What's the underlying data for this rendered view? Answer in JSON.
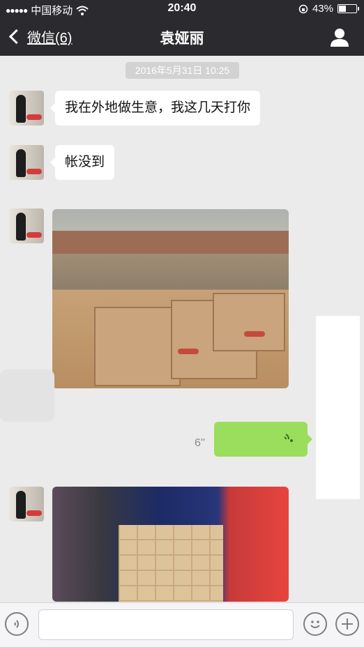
{
  "status_bar": {
    "signal_dots": "●●●●●",
    "carrier": "中国移动",
    "time": "20:40",
    "battery_percent": "43%",
    "battery_level": 0.43
  },
  "nav": {
    "back_label": "微信(6)",
    "title": "袁娅丽"
  },
  "chat": {
    "timestamp": "2016年5月31日 10:25",
    "messages": [
      {
        "from": "contact",
        "type": "text",
        "text": "我在外地做生意，我这几天打你"
      },
      {
        "from": "contact",
        "type": "text",
        "text": "帐没到"
      },
      {
        "from": "contact",
        "type": "image",
        "subject": "strawberry boxes at a market"
      },
      {
        "from": "me",
        "type": "voice",
        "duration": "6''"
      },
      {
        "from": "contact",
        "type": "image",
        "subject": "strawberry boxes in a truck"
      }
    ]
  },
  "input_bar": {
    "voice_toggle_icon": "voice-toggle-icon",
    "emoji_icon": "emoji-icon",
    "plus_icon": "plus-icon"
  },
  "colors": {
    "nav_background": "#2b2b2f",
    "chat_background": "#ebebeb",
    "sent_bubble": "#9bdd5c",
    "received_bubble": "#ffffff"
  }
}
